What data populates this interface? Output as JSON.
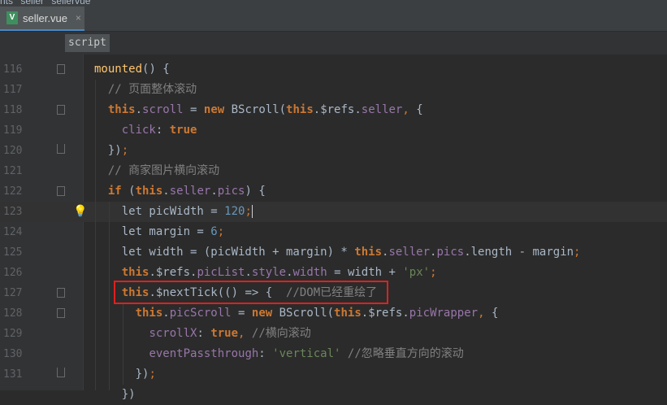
{
  "breadcrumbs": [
    "nts",
    "seller",
    "sellervue"
  ],
  "tab": {
    "label": "seller.vue",
    "icon": "vue-file-icon",
    "close": "×"
  },
  "scope": {
    "label": "script"
  },
  "lines": [
    {
      "num": "116",
      "text": "mounted() {"
    },
    {
      "num": "117",
      "text": "  // 页面整体滚动"
    },
    {
      "num": "118",
      "text": "  this.scroll = new BScroll(this.$refs.seller, {"
    },
    {
      "num": "119",
      "text": "    click: true"
    },
    {
      "num": "120",
      "text": "  });"
    },
    {
      "num": "121",
      "text": "  // 商家图片横向滚动"
    },
    {
      "num": "122",
      "text": "  if (this.seller.pics) {"
    },
    {
      "num": "123",
      "text": "    let picWidth = 120;"
    },
    {
      "num": "124",
      "text": "    let margin = 6;"
    },
    {
      "num": "125",
      "text": "    let width = (picWidth + margin) * this.seller.pics.length - margin;"
    },
    {
      "num": "126",
      "text": "    this.$refs.picList.style.width = width + 'px';"
    },
    {
      "num": "127",
      "text": "    this.$nextTick(() => {  //DOM已经重绘了"
    },
    {
      "num": "128",
      "text": "      this.picScroll = new BScroll(this.$refs.picWrapper, {"
    },
    {
      "num": "129",
      "text": "        scrollX: true, //横向滚动"
    },
    {
      "num": "130",
      "text": "        eventPassthrough: 'vertical' //忽略垂直方向的滚动"
    },
    {
      "num": "131",
      "text": "      });"
    },
    {
      "num": "",
      "text": "    })"
    }
  ],
  "colors": {
    "background": "#2b2b2b",
    "keyword": "#cc7832",
    "field": "#9876aa",
    "number": "#6897bb",
    "string": "#6a8759",
    "comment": "#808080",
    "highlight_box": "#e02020"
  }
}
